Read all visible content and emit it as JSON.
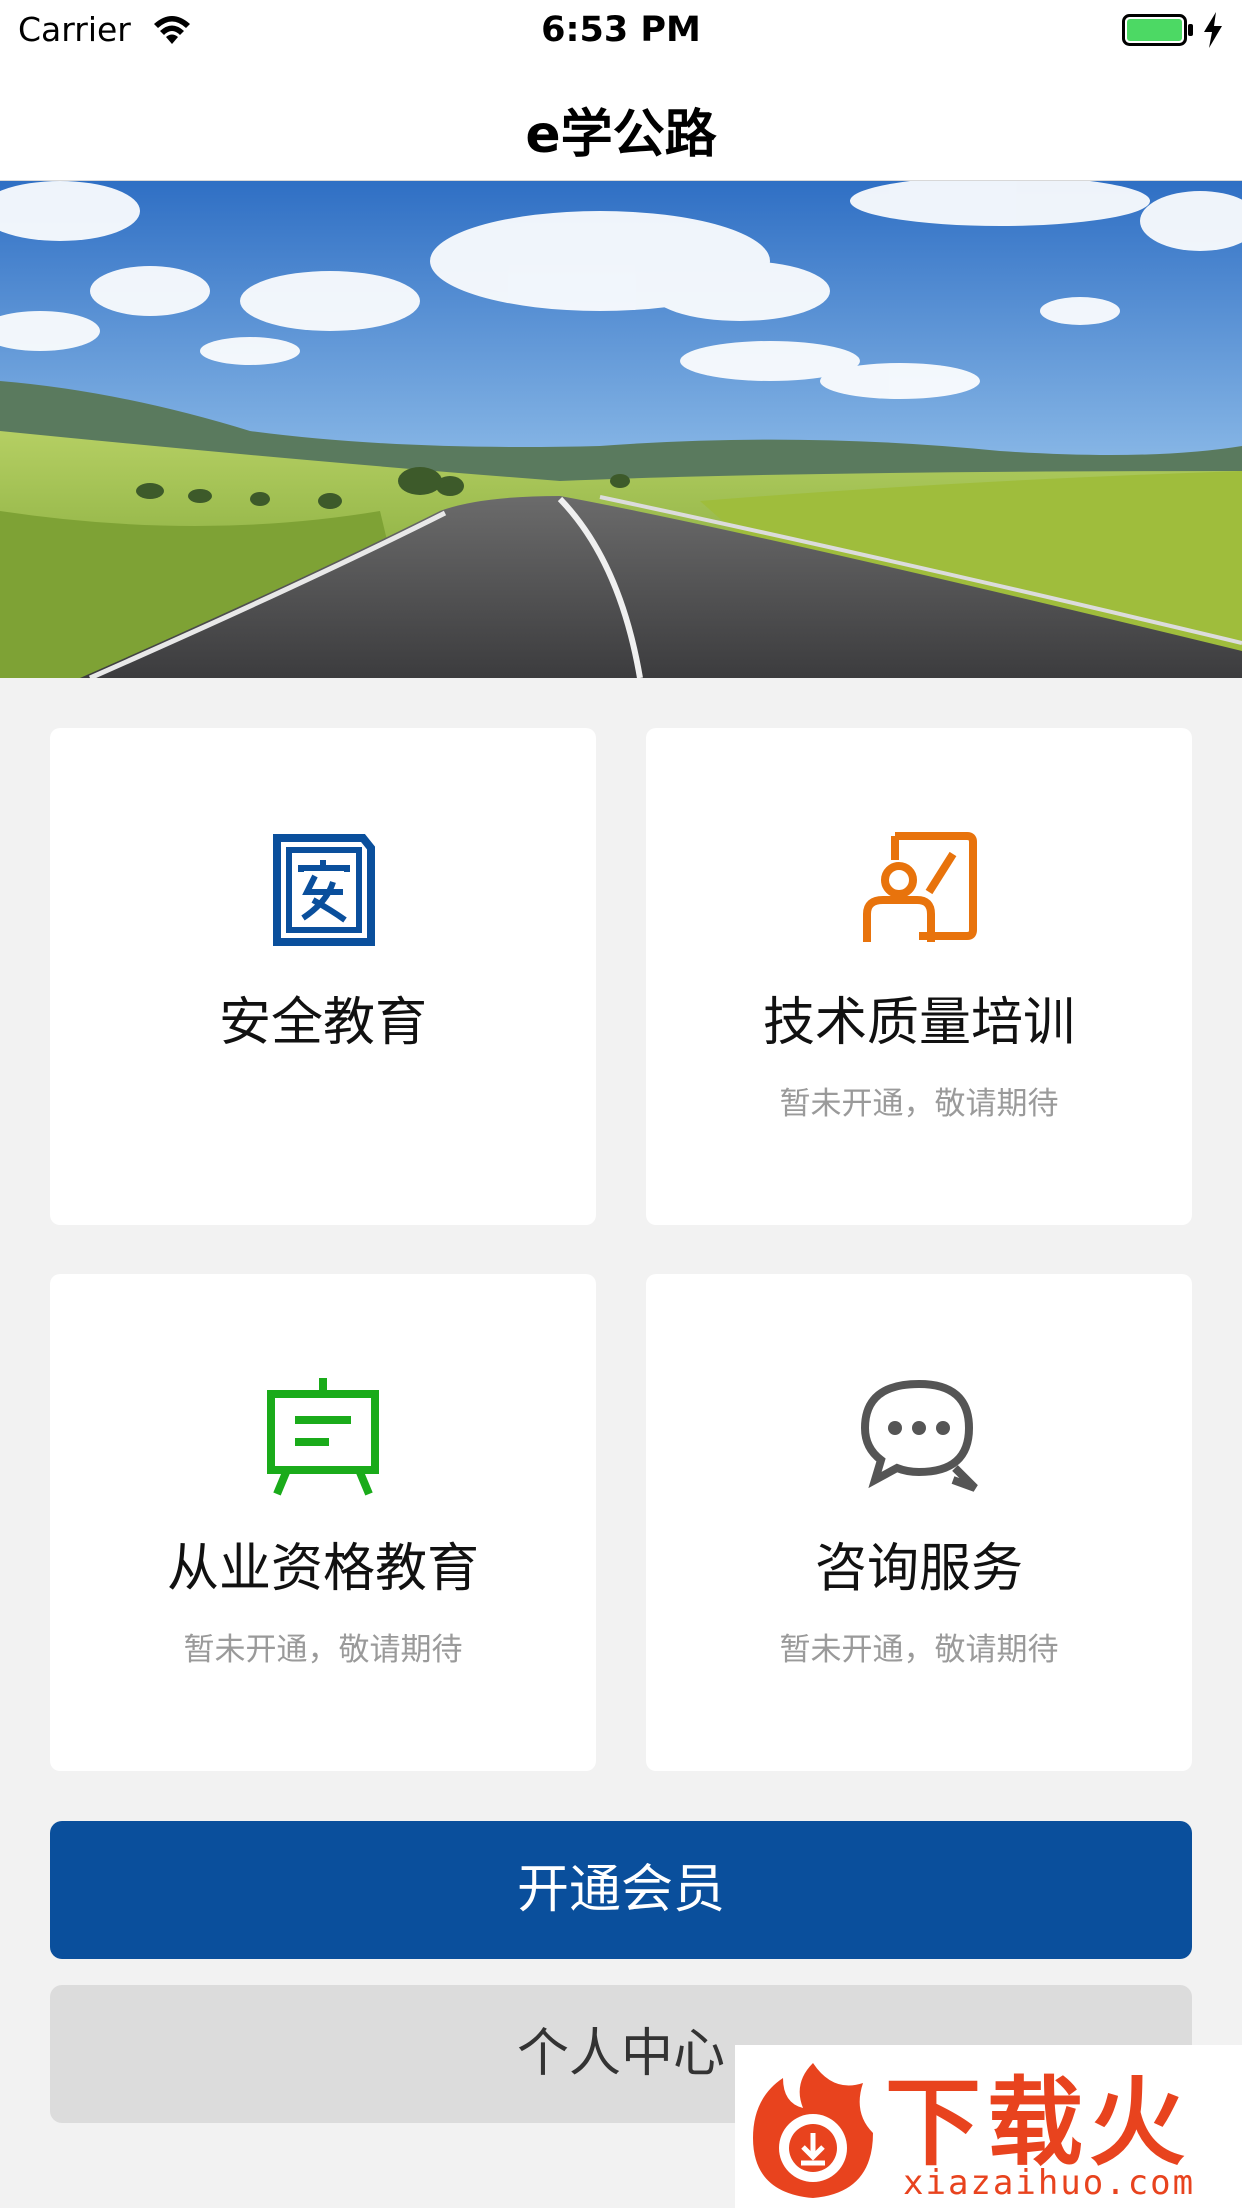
{
  "status_bar": {
    "carrier": "Carrier",
    "time": "6:53 PM",
    "icons": [
      "wifi-icon",
      "battery-icon",
      "charging-bolt-icon"
    ],
    "battery_color": "#4cd964"
  },
  "nav": {
    "title": "e学公路"
  },
  "banner": {
    "image": "road-landscape-banner"
  },
  "cards": [
    {
      "title": "安全教育",
      "subtitle": "",
      "icon": "safety-book-icon",
      "icon_color": "#0a4f9c"
    },
    {
      "title": "技术质量培训",
      "subtitle": "暂未开通，敬请期待",
      "icon": "training-icon",
      "icon_color": "#e8730c"
    },
    {
      "title": "从业资格教育",
      "subtitle": "暂未开通，敬请期待",
      "icon": "easel-board-icon",
      "icon_color": "#1aab1a"
    },
    {
      "title": "咨询服务",
      "subtitle": "暂未开通，敬请期待",
      "icon": "chat-bubbles-icon",
      "icon_color": "#555555"
    }
  ],
  "buttons": {
    "primary_label": "开通会员",
    "primary_color": "#0a4f9c",
    "secondary_label": "个人中心"
  },
  "watermark": {
    "text": "下载火",
    "url": "xiazaihuo.com",
    "color": "#e8431e"
  }
}
